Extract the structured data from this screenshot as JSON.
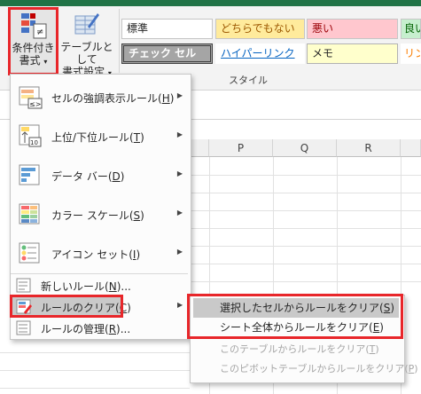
{
  "ribbon": {
    "conditional_formatting": {
      "line1": "条件付き",
      "line2": "書式",
      "caret": "▾"
    },
    "format_as_table": {
      "line1": "テーブルとして",
      "line2": "書式設定",
      "caret": "▾"
    },
    "styles_group_label": "スタイル",
    "style_cells": {
      "normal": "標準",
      "neutral": "どちらでもない",
      "bad": "悪い",
      "good_partial": "良い",
      "check_cell": "チェック セル",
      "hyperlink": "ハイパーリンク",
      "memo": "メモ",
      "linked_partial": "リン"
    }
  },
  "columns": [
    "P",
    "Q",
    "R"
  ],
  "menu": {
    "items": [
      {
        "label": "セルの強調表示ルール",
        "key": "H",
        "has_submenu": true,
        "icon": "highlight-cells-rules-icon"
      },
      {
        "label": "上位/下位ルール",
        "key": "T",
        "has_submenu": true,
        "icon": "top-bottom-rules-icon"
      },
      {
        "label": "データ バー",
        "key": "D",
        "has_submenu": true,
        "icon": "data-bars-icon"
      },
      {
        "label": "カラー スケール",
        "key": "S",
        "has_submenu": true,
        "icon": "color-scales-icon"
      },
      {
        "label": "アイコン セット",
        "key": "I",
        "has_submenu": true,
        "icon": "icon-sets-icon"
      },
      {
        "label": "新しいルール",
        "key": "N",
        "suffix": "...",
        "icon": "new-rule-icon"
      },
      {
        "label": "ルールのクリア",
        "key": "C",
        "has_submenu": true,
        "icon": "clear-rules-icon"
      },
      {
        "label": "ルールの管理",
        "key": "R",
        "suffix": "...",
        "icon": "manage-rules-icon"
      }
    ]
  },
  "submenu": {
    "items": [
      {
        "label": "選択したセルからルールをクリア",
        "key": "S",
        "enabled": true
      },
      {
        "label": "シート全体からルールをクリア",
        "key": "E",
        "enabled": true
      },
      {
        "label": "このテーブルからルールをクリア",
        "key": "T",
        "enabled": false
      },
      {
        "label": "このピボットテーブルからルールをクリア",
        "key": "P",
        "enabled": false
      }
    ]
  },
  "colors": {
    "excel_green": "#217346",
    "highlight_red": "#e8262a",
    "neutral_bg": "#ffeb9c",
    "neutral_fg": "#9c5700",
    "bad_bg": "#ffc7ce",
    "bad_fg": "#9c0006",
    "good_bg": "#c6efce",
    "good_fg": "#006100",
    "check_bg": "#a5a5a5",
    "hyperlink": "#0563c1",
    "memo_bg": "#ffffcc"
  }
}
